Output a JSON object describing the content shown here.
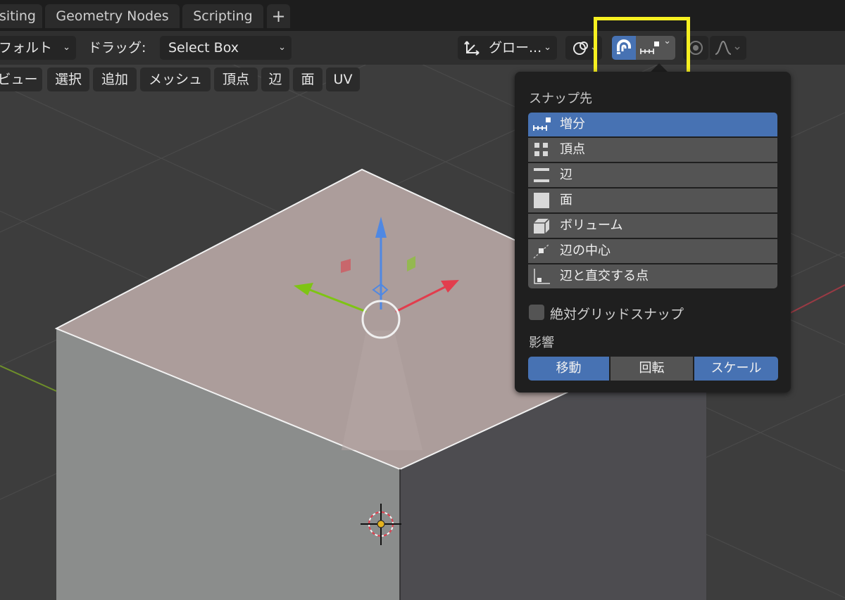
{
  "workspace_tabs": [
    "siting",
    "Geometry Nodes",
    "Scripting",
    "+"
  ],
  "header": {
    "mode_dropdown": "フォルト",
    "drag_label": "ドラッグ:",
    "drag_value": "Select Box",
    "orientation_value": "グロー...",
    "snap_icon": "magnet-icon",
    "snap_target_icon": "increment-icon",
    "proportional_icon": "proportional-edit-icon",
    "falloff_icon": "falloff-curve-icon"
  },
  "menu": [
    "ビュー",
    "選択",
    "追加",
    "メッシュ",
    "頂点",
    "辺",
    "面",
    "UV"
  ],
  "snap_popover": {
    "section_label": "スナップ先",
    "options": [
      {
        "label": "増分",
        "icon": "increment-icon",
        "selected": true
      },
      {
        "label": "頂点",
        "icon": "vertex-icon",
        "selected": false
      },
      {
        "label": "辺",
        "icon": "edge-icon",
        "selected": false
      },
      {
        "label": "面",
        "icon": "face-icon",
        "selected": false
      },
      {
        "label": "ボリューム",
        "icon": "volume-icon",
        "selected": false
      },
      {
        "label": "辺の中心",
        "icon": "edge-center-icon",
        "selected": false
      },
      {
        "label": "辺と直交する点",
        "icon": "edge-perpendicular-icon",
        "selected": false
      }
    ],
    "absolute_grid_snap": {
      "label": "絶対グリッドスナップ",
      "checked": false
    },
    "affect_label": "影響",
    "affect": [
      {
        "label": "移動",
        "active": true
      },
      {
        "label": "回転",
        "active": false
      },
      {
        "label": "スケール",
        "active": true
      }
    ]
  },
  "colors": {
    "accent": "#4772b3",
    "highlight_box": "#f7f021",
    "x_axis": "#e23d4d",
    "y_axis": "#7ec414",
    "z_axis": "#4f88e3"
  }
}
